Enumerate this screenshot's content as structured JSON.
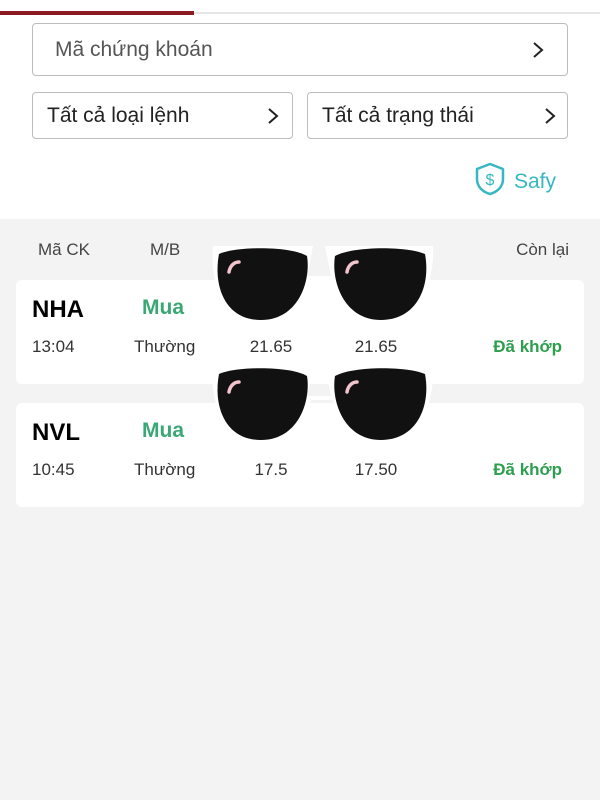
{
  "filters": {
    "stock_code_label": "Mã chứng khoán",
    "order_type_label": "Tất cả loại lệnh",
    "status_label": "Tất cả trạng thái"
  },
  "safy": {
    "label": "Safy",
    "color": "#36b7c1"
  },
  "columns": {
    "code": "Mã CK",
    "side": "M/B",
    "remaining": "Còn lại"
  },
  "orders": [
    {
      "code": "NHA",
      "side": "Mua",
      "time": "13:04",
      "order_type": "Thường",
      "price": "21.65",
      "matched_price": "21.65",
      "status": "Đã khớp"
    },
    {
      "code": "NVL",
      "side": "Mua",
      "time": "10:45",
      "order_type": "Thường",
      "price": "17.5",
      "matched_price": "17.50",
      "status": "Đã khớp"
    }
  ],
  "colors": {
    "accent": "#8b1a22",
    "buy": "#3aa875",
    "matched": "#2e9e4f"
  }
}
